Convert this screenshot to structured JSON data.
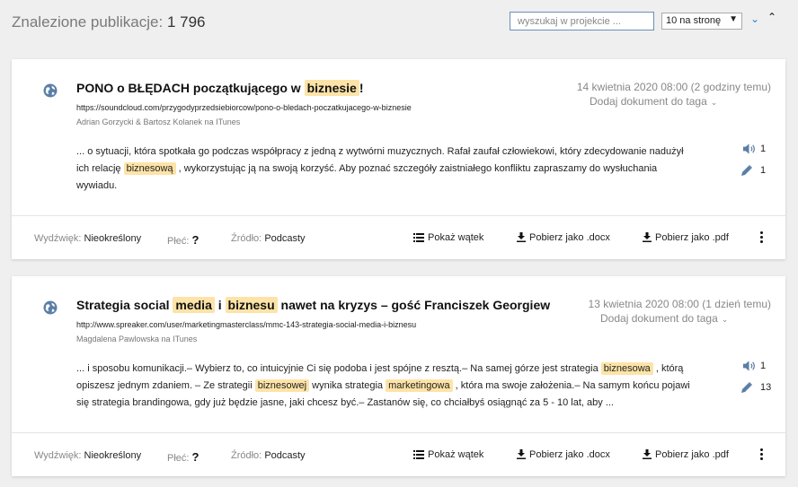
{
  "header": {
    "found_label": "Znalezione publikacje:",
    "found_count": "1 796",
    "search_placeholder": "wyszukaj w projekcie ...",
    "per_page": "10 na stronę"
  },
  "icons": {
    "globe": "globe-icon",
    "speaker": "speaker-icon",
    "pencil": "pencil-icon",
    "list": "list-icon",
    "download": "download-icon",
    "more": "more-vertical-icon"
  },
  "colors": {
    "highlight": "#fde3a7",
    "accent": "#2a86c8",
    "icon": "#5b7fa6"
  },
  "results": [
    {
      "title_parts": [
        "PONO o BŁĘDACH początkującego w ",
        "biznesie",
        "!"
      ],
      "url": "https://soundcloud.com/przygodyprzedsiebiorcow/pono-o-bledach-poczatkujacego-w-biznesie",
      "source": "Adrian Gorzycki & Bartosz Kolanek na ITunes",
      "date": "14 kwietnia 2020 08:00 (2 godziny temu)",
      "tag_dropdown": "Dodaj dokument do taga",
      "excerpt": [
        {
          "t": "... o sytuacji, która spotkała go podczas współpracy z jedną z wytwórni muzycznych. Rafał zaufał człowiekowi, który zdecydowanie nadużył ich relację "
        },
        {
          "t": "biznesową",
          "hl": true
        },
        {
          "t": " , wykorzystując ją na swoją korzyść. Aby poznać szczegóły zaistniałego konfliktu zapraszamy do wysłuchania wywiadu."
        }
      ],
      "audio_count": "1",
      "edit_count": "1",
      "footer": {
        "wydzwiek_label": "Wydźwięk:",
        "wydzwiek_value": "Nieokreślony",
        "plec_label": "Płeć:",
        "plec_value": "?",
        "zrodlo_label": "Źródło:",
        "zrodlo_value": "Podcasty",
        "show_thread": "Pokaż wątek",
        "download_docx": "Pobierz jako .docx",
        "download_pdf": "Pobierz jako .pdf"
      }
    },
    {
      "title_parts": [
        "Strategia social ",
        "media",
        " i ",
        "biznesu",
        " nawet na kryzys – gość Franciszek Georgiew"
      ],
      "url": "http://www.spreaker.com/user/marketingmasterclass/mmc-143-strategia-social-media-i-biznesu",
      "source": "Magdalena Pawlowska na ITunes",
      "date": "13 kwietnia 2020 08:00 (1 dzień temu)",
      "tag_dropdown": "Dodaj dokument do taga",
      "excerpt": [
        {
          "t": "... i sposobu komunikacji.– Wybierz to, co intuicyjnie Ci się podoba i jest spójne z resztą.– Na samej górze jest strategia "
        },
        {
          "t": "biznesowa",
          "hl": true
        },
        {
          "t": " , którą opiszesz jednym zdaniem. – Ze strategii "
        },
        {
          "t": "biznesowej",
          "hl": true
        },
        {
          "t": " wynika strategia "
        },
        {
          "t": "marketingowa",
          "hl": true
        },
        {
          "t": " , która ma swoje założenia.– Na samym końcu pojawi się strategia brandingowa, gdy już będzie jasne, jaki chcesz być.– Zastanów się, co chciałbyś osiągnąć za 5 - 10 lat, aby ..."
        }
      ],
      "audio_count": "1",
      "edit_count": "13",
      "footer": {
        "wydzwiek_label": "Wydźwięk:",
        "wydzwiek_value": "Nieokreślony",
        "plec_label": "Płeć:",
        "plec_value": "?",
        "zrodlo_label": "Źródło:",
        "zrodlo_value": "Podcasty",
        "show_thread": "Pokaż wątek",
        "download_docx": "Pobierz jako .docx",
        "download_pdf": "Pobierz jako .pdf"
      }
    }
  ]
}
